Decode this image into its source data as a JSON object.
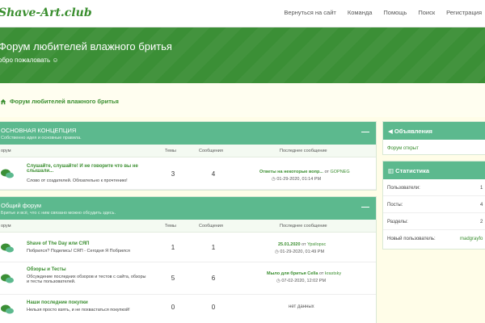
{
  "header": {
    "logo": "Shave-Art.club",
    "nav": [
      "Вернуться на сайт",
      "Команда",
      "Помощь",
      "Поиск",
      "Регистрация"
    ]
  },
  "hero": {
    "title": "Форум любителей влажного бритья",
    "subtitle": "обро пожаловать ☺"
  },
  "breadcrumb": "Форум любителей влажного бритья",
  "columns": {
    "forum": "орум",
    "topics": "Темы",
    "posts": "Сообщения",
    "last": "Последнее сообщение"
  },
  "categories": [
    {
      "title": "ОСНОВНАЯ КОНЦЕПЦИЯ",
      "desc": "Собственно идея и основные правила.",
      "forums": [
        {
          "title": "Слушайте, слушайте! И не говорите что вы не слышали...",
          "desc": "Слово от создателей. Обязательно к прочтению!",
          "topics": "3",
          "posts": "4",
          "last_title": "Ответы на некоторые вопр...",
          "last_user": "GOPNEG",
          "last_date": "01-29-2020, 01:14 PM"
        }
      ]
    },
    {
      "title": "Общий форум",
      "desc": "Бритье и всё, что с ним связано можно обсудить здесь.",
      "forums": [
        {
          "title": "Shave of The Day или СЯП",
          "desc": "Побрился? Поделись! СЯП - Сегодня Я Побрился",
          "topics": "1",
          "posts": "1",
          "last_title": "25.01.2020",
          "last_user": "Ypsilopsc",
          "last_date": "01-29-2020, 01:49 PM"
        },
        {
          "title": "Обзоры и Тесты",
          "desc": "Обсуждение последних обзоров и тестов с сайта, обзоры и тесты пользователей.",
          "topics": "5",
          "posts": "6",
          "last_title": "Мыло для бритья Cella",
          "last_user": "krastsky",
          "last_date": "07-02-2020, 12:02 PM"
        },
        {
          "title": "Наши последние покупки",
          "desc": "Нельзя просто взять, и не похвастаться покупкой!",
          "topics": "0",
          "posts": "0",
          "last_none": "нет данных"
        }
      ]
    }
  ],
  "announcements": {
    "title": "Объявления",
    "item": "Форум открыт"
  },
  "stats": {
    "title": "Статистика",
    "rows": [
      {
        "k": "Пользователи:",
        "v": "1"
      },
      {
        "k": "Посты:",
        "v": "4"
      },
      {
        "k": "Разделы:",
        "v": "2"
      },
      {
        "k": "Новый пользователь:",
        "v": "madgrayfo"
      }
    ]
  },
  "colors": {
    "brand": "#3b8f36",
    "header_green": "#5cb98e",
    "link": "#3a8e2f",
    "page_bg": "#fffde8"
  },
  "icons": [
    "home-icon",
    "forum-bubbles-icon",
    "megaphone-icon",
    "chart-icon",
    "clock-icon",
    "collapse-icon"
  ]
}
